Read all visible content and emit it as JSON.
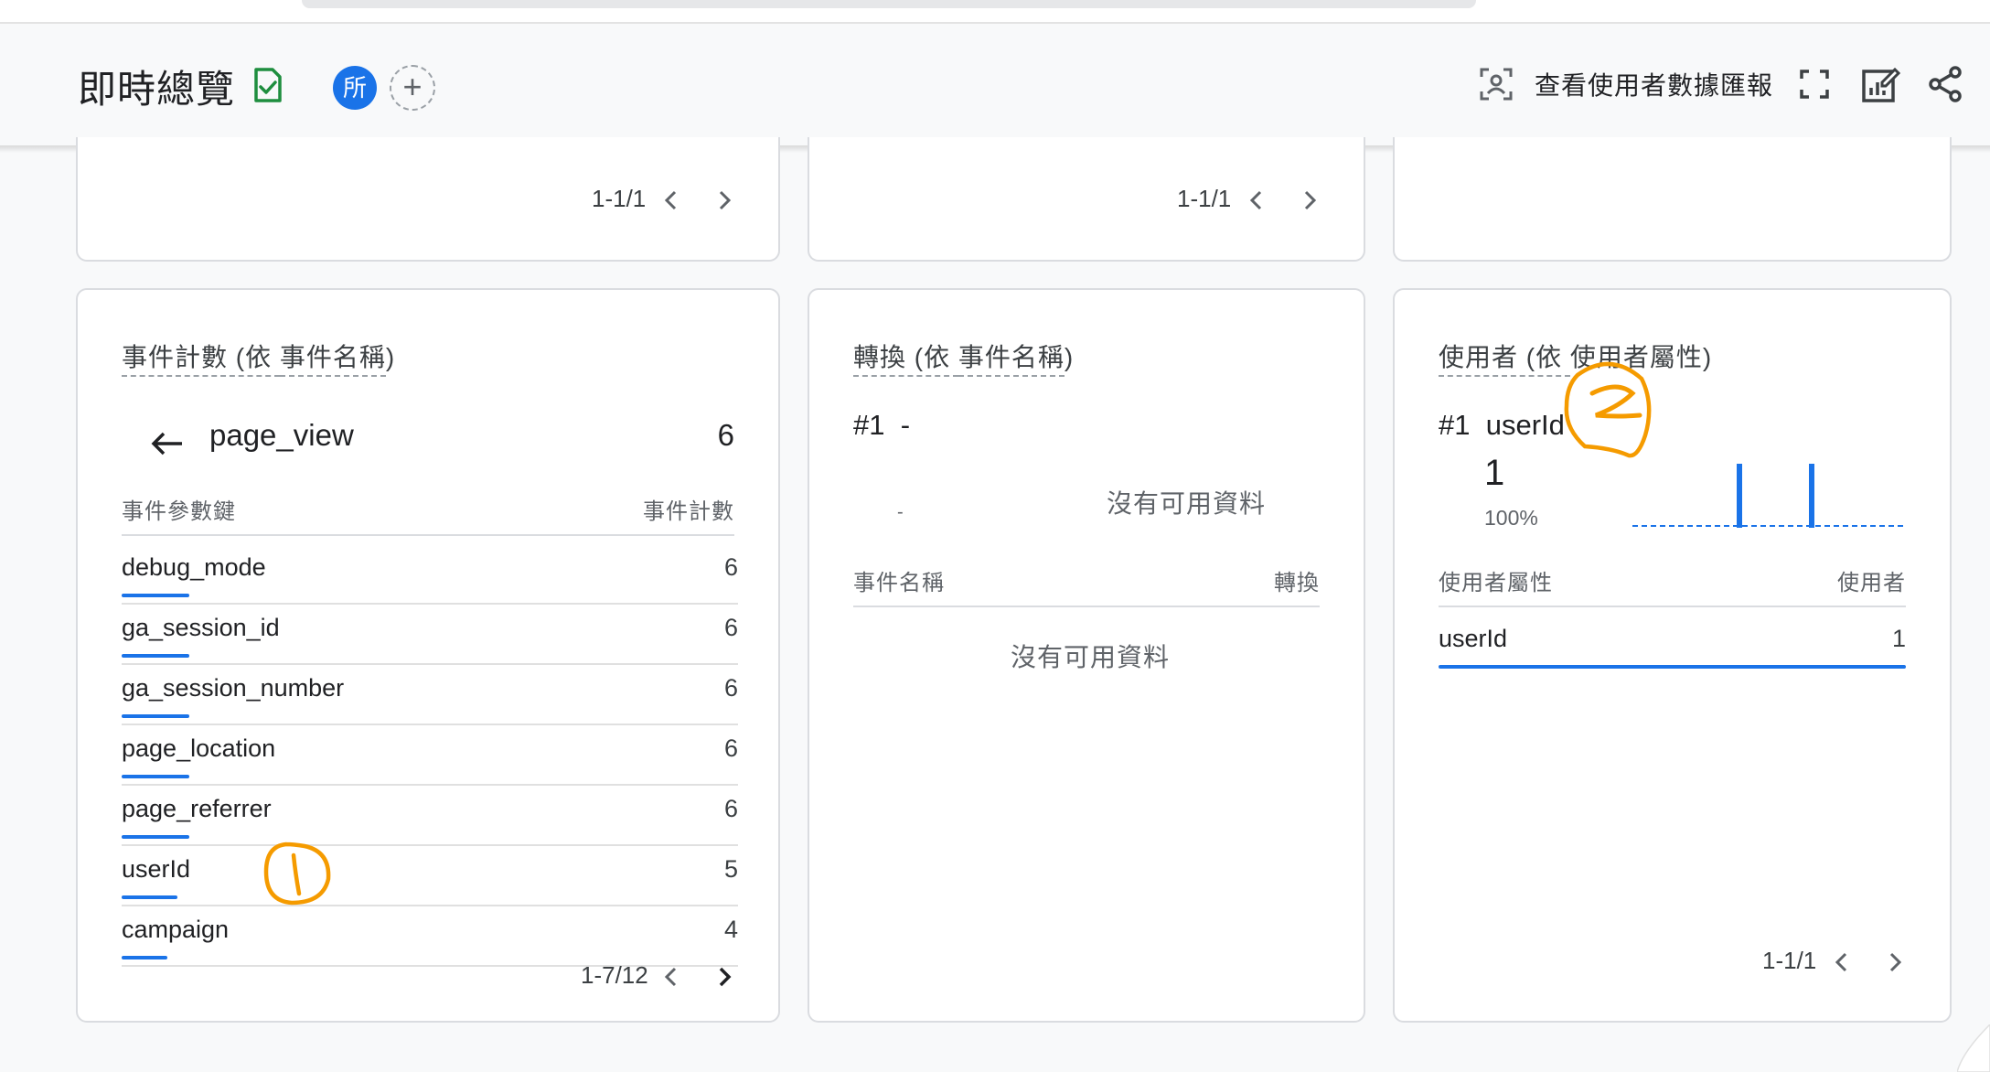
{
  "header": {
    "title": "即時總覽",
    "avatar_letter": "所",
    "add_compare_symbol": "+",
    "user_report_label": "查看使用者數據匯報",
    "icons": [
      "check-document-icon",
      "user-snapshot-icon",
      "fullscreen-icon",
      "customize-report-icon",
      "share-icon"
    ]
  },
  "top_cards": [
    {
      "pager": "1-1/1"
    },
    {
      "pager": "1-1/1"
    },
    {
      "pager": ""
    }
  ],
  "events_card": {
    "title_prefix": "事件計數 (依 ",
    "title_dim": "事件名稱",
    "title_suffix": ")",
    "selected_event": "page_view",
    "selected_count": "6",
    "col_key": "事件參數鍵",
    "col_value": "事件計數",
    "rows": [
      {
        "key": "debug_mode",
        "value": "6",
        "fraction": 1.0
      },
      {
        "key": "ga_session_id",
        "value": "6",
        "fraction": 1.0
      },
      {
        "key": "ga_session_number",
        "value": "6",
        "fraction": 1.0
      },
      {
        "key": "page_location",
        "value": "6",
        "fraction": 1.0
      },
      {
        "key": "page_referrer",
        "value": "6",
        "fraction": 1.0
      },
      {
        "key": "userId",
        "value": "5",
        "fraction": 0.83
      },
      {
        "key": "campaign",
        "value": "4",
        "fraction": 0.67
      }
    ],
    "pager": "1-7/12"
  },
  "conversions_card": {
    "title_prefix": "轉換 (依 ",
    "title_dim": "事件名稱",
    "title_suffix": ")",
    "top_item": "#1  -",
    "no_data_chart": "沒有可用資料",
    "dash": "-",
    "col_key": "事件名稱",
    "col_value": "轉換",
    "no_data_table": "沒有可用資料"
  },
  "users_card": {
    "title_prefix": "使用者 (依 ",
    "title_dim": "使用者屬性",
    "title_suffix": ")",
    "top_item": "#1  userId",
    "top_value": "1",
    "top_percent": "100%",
    "col_key": "使用者屬性",
    "col_value": "使用者",
    "rows": [
      {
        "key": "userId",
        "value": "1",
        "fraction": 1.0
      }
    ],
    "pager": "1-1/1",
    "accent_color": "#1a73e8"
  },
  "annotations": {
    "handwritten_1": "1",
    "handwritten_2": "2",
    "color": "#f59b00"
  }
}
